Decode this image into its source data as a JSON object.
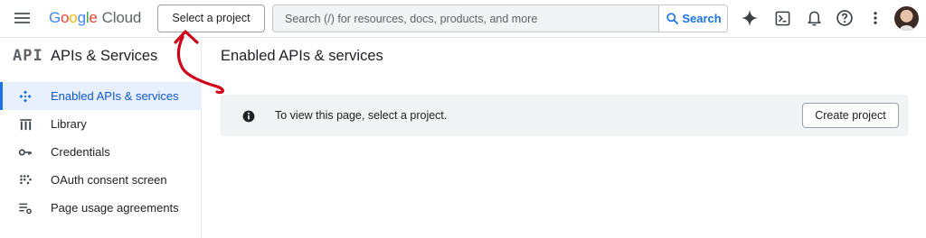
{
  "header": {
    "logo": {
      "google": [
        "G",
        "o",
        "o",
        "g",
        "l",
        "e"
      ],
      "product": "Cloud"
    },
    "project_button": "Select a project",
    "search": {
      "placeholder": "Search (/) for resources, docs, products, and more",
      "button_label": "Search"
    },
    "icons": [
      "gemini-sparkle-icon",
      "cloud-shell-icon",
      "notifications-bell-icon",
      "help-icon",
      "more-vert-icon"
    ]
  },
  "sidebar": {
    "logo": "API",
    "title": "APIs & Services",
    "items": [
      {
        "label": "Enabled APIs & services",
        "icon": "enabled-apis-icon",
        "active": true
      },
      {
        "label": "Library",
        "icon": "library-icon",
        "active": false
      },
      {
        "label": "Credentials",
        "icon": "key-icon",
        "active": false
      },
      {
        "label": "OAuth consent screen",
        "icon": "oauth-icon",
        "active": false
      },
      {
        "label": "Page usage agreements",
        "icon": "settings-list-icon",
        "active": false
      }
    ]
  },
  "main": {
    "title": "Enabled APIs & services",
    "notice": {
      "text": "To view this page, select a project.",
      "button": "Create project"
    }
  },
  "colors": {
    "accent": "#1a73e8",
    "active_bg": "#e8f0fe",
    "annotation": "#d0021b"
  }
}
